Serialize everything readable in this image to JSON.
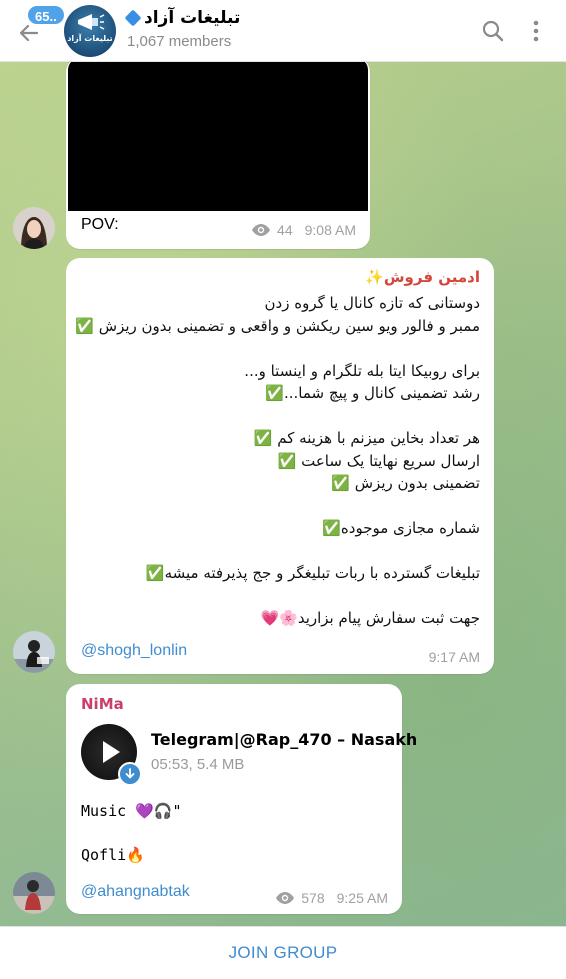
{
  "header": {
    "unread_count": "65..",
    "title": "تبلیغات آزاد",
    "members": "1,067 members",
    "avatar_text": "تبلیغات آزاد",
    "icons": [
      "back-arrow-icon",
      "verified-icon",
      "search-icon",
      "more-vertical-icon"
    ]
  },
  "messages": [
    {
      "caption": "POV:",
      "views": "44",
      "time": "9:08 AM"
    },
    {
      "sender": "ادمین فروش✨",
      "lines": [
        "دوستانی که تازه کانال یا گروه زدن",
        "ممبر و فالور ویو سین ریکشن و واقعی و تضمینی بدون ریزش ✅",
        "",
        "برای روبیکا ایتا بله تلگرام و اینستا و...",
        "رشد تضمینی کانال و پیچ شما...✅",
        "",
        "هر تعداد بخاین میزنم با هزینه کم ✅",
        "ارسال سریع نهایتا یک ساعت ✅",
        "تضمینی بدون ریزش ✅",
        "",
        "شماره مجازی موجوده✅",
        "",
        "تبلیغات گسترده با ربات تبلیغگر و جج پذیرفته میشه✅",
        "",
        "جهت ثبت سفارش پیام بزارید🌸💗"
      ],
      "username": "@shogh_lonlin",
      "time": "9:17 AM"
    },
    {
      "sender": "NiMa",
      "music_title": "Telegram|@Rap_470 – Nasakh",
      "music_info": "05:53, 5.4 MB",
      "line1": "Music 💜🎧\"",
      "line2": "Qofli🔥",
      "username": "@ahangnabtak",
      "views": "578",
      "time": "9:25 AM"
    }
  ],
  "join_label": "JOIN GROUP",
  "colors": {
    "accent": "#3f8ccf",
    "admin_name": "#d4463b",
    "nima_name": "#c9406a",
    "badge": "#50a2e9"
  }
}
